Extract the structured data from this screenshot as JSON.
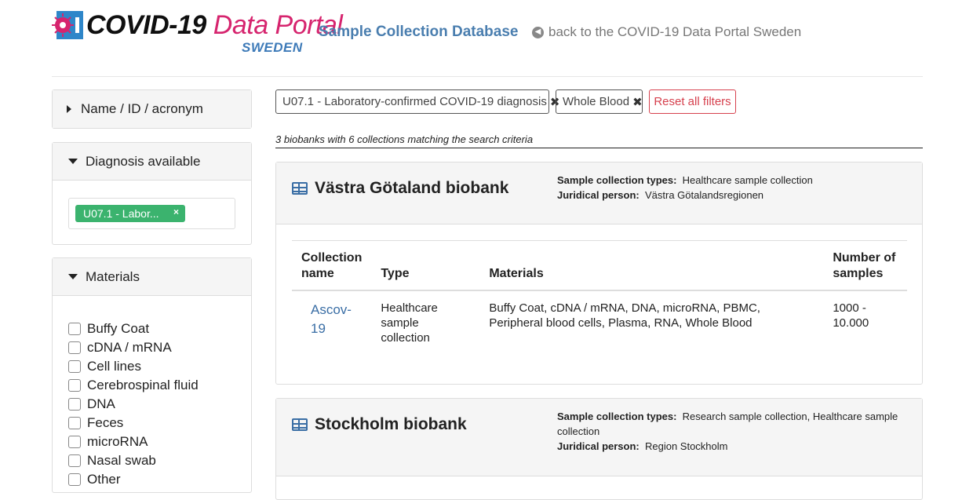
{
  "header": {
    "logo_primary": "COVID-19",
    "logo_secondary": "Data Portal",
    "logo_sub": "SWEDEN",
    "db_title": "Sample Collection Database",
    "back_link": "back to the COVID-19 Data Portal Sweden"
  },
  "sidebar": {
    "name_panel": {
      "label": "Name / ID / acronym"
    },
    "diagnosis_panel": {
      "label": "Diagnosis available",
      "chip": "U07.1 - Labor..."
    },
    "materials_panel": {
      "label": "Materials",
      "items": [
        "Buffy Coat",
        "cDNA / mRNA",
        "Cell lines",
        "Cerebrospinal fluid",
        "DNA",
        "Feces",
        "microRNA",
        "Nasal swab",
        "Other"
      ]
    }
  },
  "filters": {
    "chips": [
      "U07.1 - Laboratory-confirmed COVID-19 diagnosis",
      "Whole Blood"
    ],
    "reset_label": "Reset all filters"
  },
  "summary": "3 biobanks with 6 collections matching the search criteria",
  "biobanks": [
    {
      "name": "Västra Götaland biobank",
      "sample_types_label": "Sample collection types:",
      "sample_types": "Healthcare sample collection",
      "juridical_label": "Juridical person:",
      "juridical": "Västra Götalandsregionen",
      "columns": [
        "Collection name",
        "Type",
        "Materials",
        "Number of samples"
      ],
      "rows": [
        {
          "name": "Ascov-19",
          "type": "Healthcare sample collection",
          "materials": "Buffy Coat, cDNA / mRNA, DNA, microRNA, PBMC, Peripheral blood cells, Plasma, RNA, Whole Blood",
          "samples": "1000 - 10.000"
        }
      ]
    },
    {
      "name": "Stockholm biobank",
      "sample_types_label": "Sample collection types:",
      "sample_types": "Research sample collection, Healthcare sample collection",
      "juridical_label": "Juridical person:",
      "juridical": "Region Stockholm"
    }
  ],
  "colors": {
    "accent_blue": "#4a7eaf",
    "logo_pink": "#d6246e",
    "chip_green": "#3bb36e",
    "reset_red": "#d6414e"
  },
  "icons": {
    "back": "arrow-left-circle-icon",
    "biobank": "table-icon",
    "collapsed": "caret-right-icon",
    "expanded": "caret-down-icon"
  }
}
